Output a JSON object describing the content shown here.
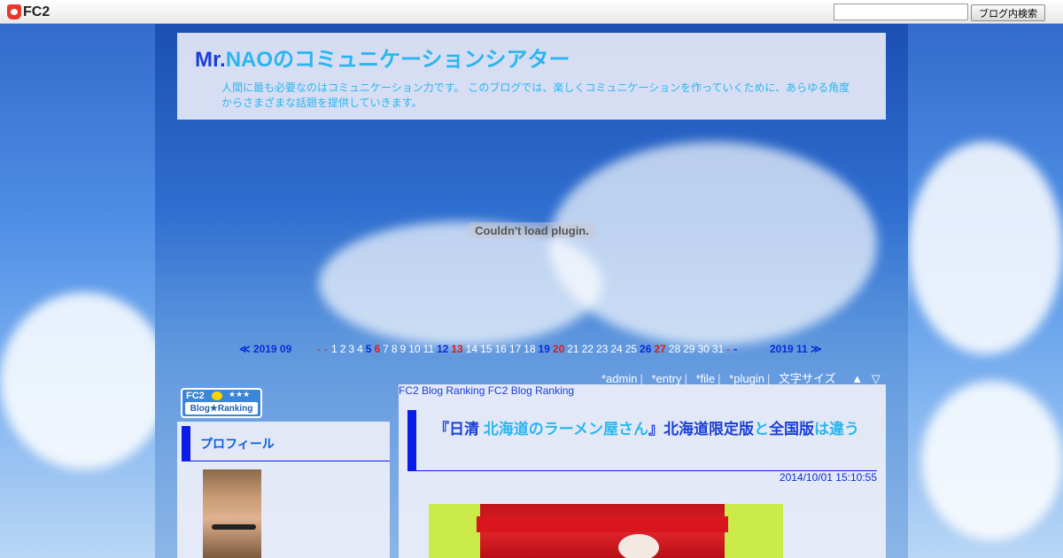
{
  "fc2bar": {
    "logo_text": "FC2",
    "search_placeholder": "",
    "search_button": "ブログ内検索"
  },
  "header": {
    "title_pre": "Mr.",
    "title_rest": "NAOのコミュニケーションシアター",
    "description": "人間に最も必要なのはコミュニケーション力です。 このブログでは、楽しくコミュニケーションを作っていくために、あらゆる角度からさまざまな話題を提供していきます。"
  },
  "plugin_message": "Couldn't load plugin.",
  "calendar": {
    "prev": "≪ 2019 09",
    "next": "2019 11 ≫",
    "days": [
      {
        "n": "-",
        "t": "dash"
      },
      {
        "n": "-",
        "t": "dash"
      },
      {
        "n": "1",
        "t": ""
      },
      {
        "n": "2",
        "t": ""
      },
      {
        "n": "3",
        "t": ""
      },
      {
        "n": "4",
        "t": ""
      },
      {
        "n": "5",
        "t": "sat"
      },
      {
        "n": "6",
        "t": "sun"
      },
      {
        "n": "7",
        "t": ""
      },
      {
        "n": "8",
        "t": ""
      },
      {
        "n": "9",
        "t": ""
      },
      {
        "n": "10",
        "t": ""
      },
      {
        "n": "11",
        "t": ""
      },
      {
        "n": "12",
        "t": "sat"
      },
      {
        "n": "13",
        "t": "sun"
      },
      {
        "n": "14",
        "t": ""
      },
      {
        "n": "15",
        "t": ""
      },
      {
        "n": "16",
        "t": ""
      },
      {
        "n": "17",
        "t": ""
      },
      {
        "n": "18",
        "t": ""
      },
      {
        "n": "19",
        "t": "sat"
      },
      {
        "n": "20",
        "t": "sun"
      },
      {
        "n": "21",
        "t": ""
      },
      {
        "n": "22",
        "t": ""
      },
      {
        "n": "23",
        "t": ""
      },
      {
        "n": "24",
        "t": ""
      },
      {
        "n": "25",
        "t": ""
      },
      {
        "n": "26",
        "t": "sat"
      },
      {
        "n": "27",
        "t": "sun"
      },
      {
        "n": "28",
        "t": ""
      },
      {
        "n": "29",
        "t": ""
      },
      {
        "n": "30",
        "t": ""
      },
      {
        "n": "31",
        "t": ""
      },
      {
        "n": "-",
        "t": "dash"
      },
      {
        "n": "-",
        "t": "sat"
      }
    ]
  },
  "admin_links": {
    "admin": "*admin",
    "entry": "*entry",
    "file": "*file",
    "plugin": "*plugin",
    "font_size": "文字サイズ",
    "up": "▲",
    "down": "▽",
    "sep": "|"
  },
  "ranking_badge": {
    "top": "FC2",
    "stars": "★★★",
    "bottom": "Blog★Ranking"
  },
  "sidebar": {
    "profile_heading": "プロフィール"
  },
  "main": {
    "rank_links": "FC2 Blog Ranking FC2 Blog Ranking",
    "entry_title_parts": [
      {
        "text": "『日清 ",
        "hl": false
      },
      {
        "text": "北海道のラーメン屋さん",
        "hl": true
      },
      {
        "text": "』",
        "hl": false
      },
      {
        "text": "北海道限定版",
        "hl": false
      },
      {
        "text": "と",
        "hl": true
      },
      {
        "text": "全国版",
        "hl": false
      },
      {
        "text": "は違う",
        "hl": true
      }
    ],
    "entry_date": "2014/10/01 15:10:55"
  }
}
